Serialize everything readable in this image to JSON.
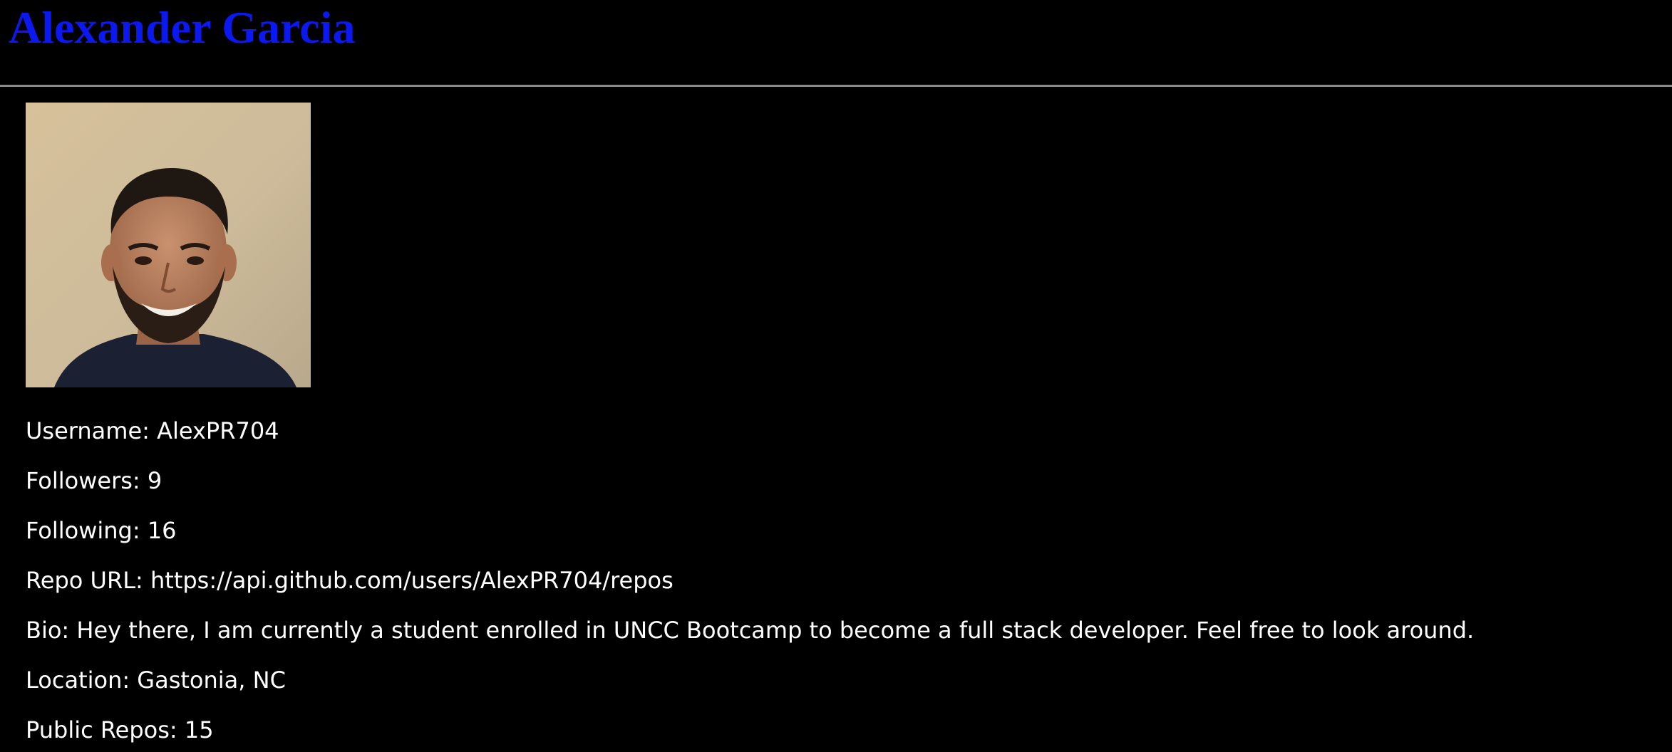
{
  "header": {
    "title": "Alexander Garcia",
    "title_color": "#0b18f0"
  },
  "profile": {
    "avatar_icon": "profile-photo",
    "fields": [
      {
        "label": "Username",
        "value": "AlexPR704",
        "text": "Username: AlexPR704"
      },
      {
        "label": "Followers",
        "value": "9",
        "text": "Followers: 9"
      },
      {
        "label": "Following",
        "value": "16",
        "text": "Following: 16"
      },
      {
        "label": "Repo URL",
        "value": "https://api.github.com/users/AlexPR704/repos",
        "text": "Repo URL: https://api.github.com/users/AlexPR704/repos"
      },
      {
        "label": "Bio",
        "value": "Hey there, I am currently a student enrolled in UNCC Bootcamp to become a full stack developer. Feel free to look around.",
        "text": "Bio: Hey there, I am currently a student enrolled in UNCC Bootcamp to become a full stack developer. Feel free to look around."
      },
      {
        "label": "Location",
        "value": "Gastonia, NC",
        "text": "Location: Gastonia, NC"
      },
      {
        "label": "Public Repos",
        "value": "15",
        "text": "Public Repos: 15"
      }
    ]
  },
  "colors": {
    "background": "#000000",
    "text": "#ffffff",
    "rule": "#8a8a8a"
  }
}
